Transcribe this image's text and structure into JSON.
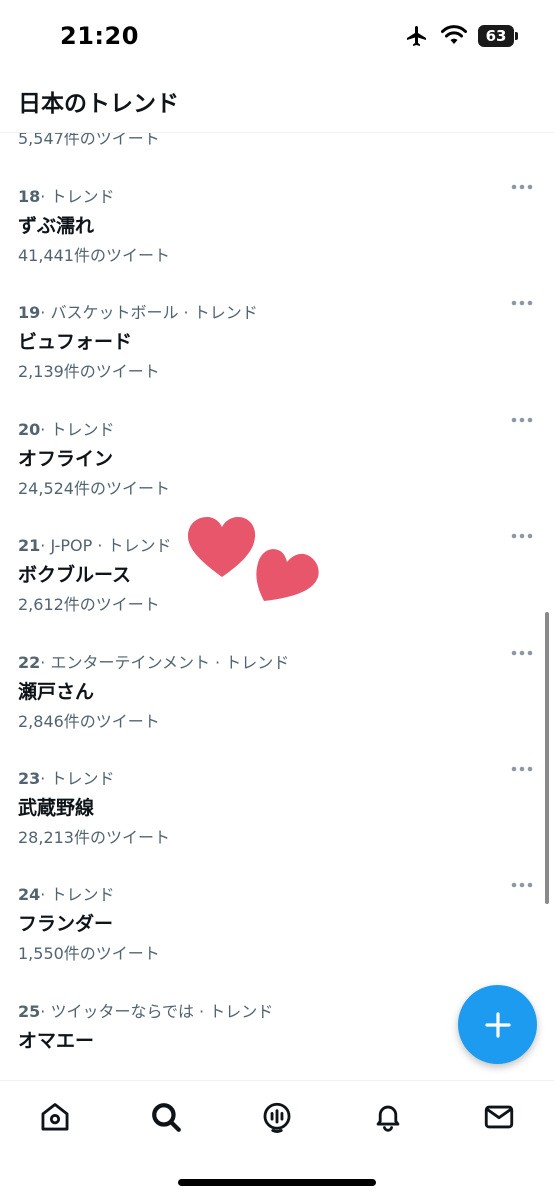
{
  "status": {
    "time": "21:20",
    "battery": "63"
  },
  "header": {
    "title": "日本のトレンド"
  },
  "partial_previous": {
    "count": "5,547件のツイート"
  },
  "trends": [
    {
      "rank": "18",
      "category": "· トレンド",
      "name": "ずぶ濡れ",
      "count": "41,441件のツイート"
    },
    {
      "rank": "19",
      "category": "· バスケットボール · トレンド",
      "name": "ビュフォード",
      "count": "2,139件のツイート"
    },
    {
      "rank": "20",
      "category": "· トレンド",
      "name": "オフライン",
      "count": "24,524件のツイート"
    },
    {
      "rank": "21",
      "category": "· J-POP · トレンド",
      "name": "ボクブルース",
      "count": "2,612件のツイート"
    },
    {
      "rank": "22",
      "category": "· エンターテインメント · トレンド",
      "name": "瀬戸さん",
      "count": "2,846件のツイート"
    },
    {
      "rank": "23",
      "category": "· トレンド",
      "name": "武蔵野線",
      "count": "28,213件のツイート"
    },
    {
      "rank": "24",
      "category": "· トレンド",
      "name": "フランダー",
      "count": "1,550件のツイート"
    },
    {
      "rank": "25",
      "category": "· ツイッターならでは · トレンド",
      "name": "オマエー",
      "count": ""
    }
  ],
  "colors": {
    "accent": "#1d9bf0",
    "text": "#0f1419",
    "secondary": "#536471",
    "heart": "#e8566c"
  },
  "icons": {
    "fab": "plus-icon",
    "tabs": [
      "home-icon",
      "search-icon",
      "spaces-icon",
      "notifications-icon",
      "messages-icon"
    ]
  }
}
